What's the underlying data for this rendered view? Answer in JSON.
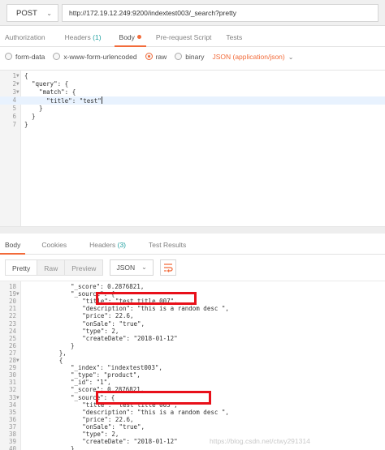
{
  "request": {
    "method": "POST",
    "url": "http://172.19.12.249:9200/indextest003/_search?pretty",
    "tabs": [
      {
        "label": "Authorization"
      },
      {
        "label": "Headers",
        "count": "(1)"
      },
      {
        "label": "Body"
      },
      {
        "label": "Pre-request Script"
      },
      {
        "label": "Tests"
      }
    ],
    "active_tab": "Body",
    "body_options": [
      "form-data",
      "x-www-form-urlencoded",
      "raw",
      "binary"
    ],
    "selected_option": "raw",
    "content_type": "JSON (application/json)",
    "lines": [
      {
        "n": "1",
        "fold": true,
        "text": "{"
      },
      {
        "n": "2",
        "fold": true,
        "text": "  \"query\": {"
      },
      {
        "n": "3",
        "fold": true,
        "text": "    \"match\": {"
      },
      {
        "n": "4",
        "fold": false,
        "text": "      \"title\": \"test\""
      },
      {
        "n": "5",
        "fold": false,
        "text": "    }"
      },
      {
        "n": "6",
        "fold": false,
        "text": "  }"
      },
      {
        "n": "7",
        "fold": false,
        "text": "}"
      }
    ]
  },
  "response": {
    "tabs": [
      {
        "label": "Body"
      },
      {
        "label": "Cookies"
      },
      {
        "label": "Headers",
        "count": "(3)"
      },
      {
        "label": "Test Results"
      }
    ],
    "active_tab": "Body",
    "view_modes": [
      "Pretty",
      "Raw",
      "Preview"
    ],
    "active_view": "Pretty",
    "format": "JSON",
    "lines": [
      {
        "n": "18",
        "indent": 8,
        "fold": false,
        "text": "\"_score\": 0.2876821,"
      },
      {
        "n": "19",
        "indent": 8,
        "fold": true,
        "text": "\"_source\": {"
      },
      {
        "n": "20",
        "indent": 10,
        "fold": false,
        "text": "\"title\": \"test title 007\","
      },
      {
        "n": "21",
        "indent": 10,
        "fold": false,
        "text": "\"description\": \"this is a random desc \","
      },
      {
        "n": "22",
        "indent": 10,
        "fold": false,
        "text": "\"price\": 22.6,"
      },
      {
        "n": "23",
        "indent": 10,
        "fold": false,
        "text": "\"onSale\": \"true\","
      },
      {
        "n": "24",
        "indent": 10,
        "fold": false,
        "text": "\"type\": 2,"
      },
      {
        "n": "25",
        "indent": 10,
        "fold": false,
        "text": "\"createDate\": \"2018-01-12\""
      },
      {
        "n": "26",
        "indent": 8,
        "fold": false,
        "text": "}"
      },
      {
        "n": "27",
        "indent": 6,
        "fold": false,
        "text": "},"
      },
      {
        "n": "28",
        "indent": 6,
        "fold": true,
        "text": "{"
      },
      {
        "n": "29",
        "indent": 8,
        "fold": false,
        "text": "\"_index\": \"indextest003\","
      },
      {
        "n": "30",
        "indent": 8,
        "fold": false,
        "text": "\"_type\": \"product\","
      },
      {
        "n": "31",
        "indent": 8,
        "fold": false,
        "text": "\"_id\": \"1\","
      },
      {
        "n": "32",
        "indent": 8,
        "fold": false,
        "text": "\"_score\": 0.2876821,"
      },
      {
        "n": "33",
        "indent": 8,
        "fold": true,
        "text": "\"_source\": {"
      },
      {
        "n": "34",
        "indent": 10,
        "fold": false,
        "text": "\"title\": \"test title 003\","
      },
      {
        "n": "35",
        "indent": 10,
        "fold": false,
        "text": "\"description\": \"this is a random desc \","
      },
      {
        "n": "36",
        "indent": 10,
        "fold": false,
        "text": "\"price\": 22.6,"
      },
      {
        "n": "37",
        "indent": 10,
        "fold": false,
        "text": "\"onSale\": \"true\","
      },
      {
        "n": "38",
        "indent": 10,
        "fold": false,
        "text": "\"type\": 2,"
      },
      {
        "n": "39",
        "indent": 10,
        "fold": false,
        "text": "\"createDate\": \"2018-01-12\""
      },
      {
        "n": "40",
        "indent": 8,
        "fold": false,
        "text": "}"
      }
    ]
  },
  "watermark": "https://blog.csdn.net/ctwy291314",
  "colors": {
    "accent": "#f26b3a",
    "highlight_box": "#e8101a",
    "count": "#20a0a0"
  }
}
